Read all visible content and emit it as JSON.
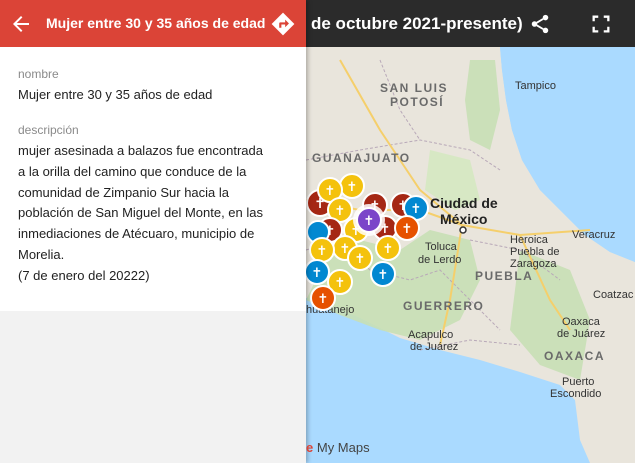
{
  "map": {
    "title": "de octubre 2021-presente)",
    "attribution": "My Maps",
    "labels": [
      {
        "id": "san-luis-1",
        "text": "SAN LUIS",
        "kind": "state"
      },
      {
        "id": "san-luis-2",
        "text": "POTOSÍ",
        "kind": "state"
      },
      {
        "id": "tampico",
        "text": "Tampico",
        "kind": "city"
      },
      {
        "id": "guanajuato",
        "text": "GUANAJUATO",
        "kind": "state"
      },
      {
        "id": "cdmx-1",
        "text": "Ciudad de",
        "kind": "capital"
      },
      {
        "id": "cdmx-2",
        "text": "México",
        "kind": "capital"
      },
      {
        "id": "toluca-1",
        "text": "Toluca",
        "kind": "city"
      },
      {
        "id": "toluca-2",
        "text": "de Lerdo",
        "kind": "city"
      },
      {
        "id": "heroica-1",
        "text": "Heroica",
        "kind": "city"
      },
      {
        "id": "heroica-2",
        "text": "Puebla de",
        "kind": "city"
      },
      {
        "id": "heroica-3",
        "text": "Zaragoza",
        "kind": "city"
      },
      {
        "id": "veracruz",
        "text": "Veracruz",
        "kind": "city"
      },
      {
        "id": "puebla",
        "text": "PUEBLA",
        "kind": "state"
      },
      {
        "id": "coatzacoalcos",
        "text": "Coatzac",
        "kind": "city"
      },
      {
        "id": "guerrero",
        "text": "GUERRERO",
        "kind": "state"
      },
      {
        "id": "acapulco-1",
        "text": "Acapulco",
        "kind": "city"
      },
      {
        "id": "acapulco-2",
        "text": "de Juárez",
        "kind": "city"
      },
      {
        "id": "oaxaca-city-1",
        "text": "Oaxaca",
        "kind": "city"
      },
      {
        "id": "oaxaca-city-2",
        "text": "de Juárez",
        "kind": "city"
      },
      {
        "id": "oaxaca",
        "text": "OAXACA",
        "kind": "state"
      },
      {
        "id": "puerto-1",
        "text": "Puerto",
        "kind": "city"
      },
      {
        "id": "puerto-2",
        "text": "Escondido",
        "kind": "city"
      },
      {
        "id": "zihuatanejo",
        "text": "huatanejo",
        "kind": "city"
      }
    ],
    "marker_colors": {
      "yellow": "#f4c20d",
      "red": "#a52714",
      "blue": "#0288d1",
      "orange": "#e65100",
      "purple": "#7b45c9"
    }
  },
  "panel": {
    "title": "Mujer entre 30 y 35 años de edad",
    "name_label": "nombre",
    "name_value": "Mujer entre 30 y 35 años de edad",
    "description_label": "descripción",
    "description_lines": [
      "mujer asesinada a balazos fue encontrada",
      "a la orilla del camino que conduce de la",
      "comunidad de Zimpanio Sur hacia la",
      "población de San Miguel del Monte, en las",
      "inmediaciones de Atécuaro, municipio de",
      "Morelia.",
      "(7 de enero del 20222)"
    ]
  },
  "icons": {
    "back": "arrow-left-icon",
    "directions": "directions-icon",
    "share": "share-icon",
    "fullscreen": "fullscreen-icon"
  }
}
